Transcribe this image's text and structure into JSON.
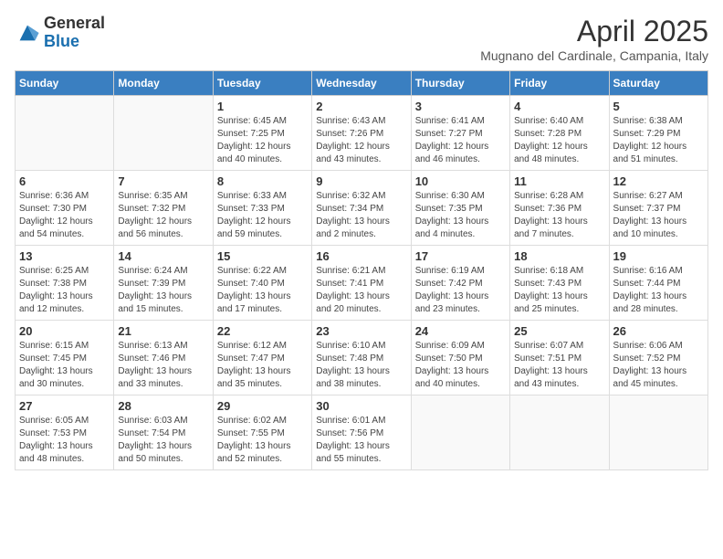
{
  "logo": {
    "general": "General",
    "blue": "Blue"
  },
  "title": "April 2025",
  "subtitle": "Mugnano del Cardinale, Campania, Italy",
  "days_of_week": [
    "Sunday",
    "Monday",
    "Tuesday",
    "Wednesday",
    "Thursday",
    "Friday",
    "Saturday"
  ],
  "weeks": [
    [
      {
        "day": "",
        "info": ""
      },
      {
        "day": "",
        "info": ""
      },
      {
        "day": "1",
        "info": "Sunrise: 6:45 AM\nSunset: 7:25 PM\nDaylight: 12 hours and 40 minutes."
      },
      {
        "day": "2",
        "info": "Sunrise: 6:43 AM\nSunset: 7:26 PM\nDaylight: 12 hours and 43 minutes."
      },
      {
        "day": "3",
        "info": "Sunrise: 6:41 AM\nSunset: 7:27 PM\nDaylight: 12 hours and 46 minutes."
      },
      {
        "day": "4",
        "info": "Sunrise: 6:40 AM\nSunset: 7:28 PM\nDaylight: 12 hours and 48 minutes."
      },
      {
        "day": "5",
        "info": "Sunrise: 6:38 AM\nSunset: 7:29 PM\nDaylight: 12 hours and 51 minutes."
      }
    ],
    [
      {
        "day": "6",
        "info": "Sunrise: 6:36 AM\nSunset: 7:30 PM\nDaylight: 12 hours and 54 minutes."
      },
      {
        "day": "7",
        "info": "Sunrise: 6:35 AM\nSunset: 7:32 PM\nDaylight: 12 hours and 56 minutes."
      },
      {
        "day": "8",
        "info": "Sunrise: 6:33 AM\nSunset: 7:33 PM\nDaylight: 12 hours and 59 minutes."
      },
      {
        "day": "9",
        "info": "Sunrise: 6:32 AM\nSunset: 7:34 PM\nDaylight: 13 hours and 2 minutes."
      },
      {
        "day": "10",
        "info": "Sunrise: 6:30 AM\nSunset: 7:35 PM\nDaylight: 13 hours and 4 minutes."
      },
      {
        "day": "11",
        "info": "Sunrise: 6:28 AM\nSunset: 7:36 PM\nDaylight: 13 hours and 7 minutes."
      },
      {
        "day": "12",
        "info": "Sunrise: 6:27 AM\nSunset: 7:37 PM\nDaylight: 13 hours and 10 minutes."
      }
    ],
    [
      {
        "day": "13",
        "info": "Sunrise: 6:25 AM\nSunset: 7:38 PM\nDaylight: 13 hours and 12 minutes."
      },
      {
        "day": "14",
        "info": "Sunrise: 6:24 AM\nSunset: 7:39 PM\nDaylight: 13 hours and 15 minutes."
      },
      {
        "day": "15",
        "info": "Sunrise: 6:22 AM\nSunset: 7:40 PM\nDaylight: 13 hours and 17 minutes."
      },
      {
        "day": "16",
        "info": "Sunrise: 6:21 AM\nSunset: 7:41 PM\nDaylight: 13 hours and 20 minutes."
      },
      {
        "day": "17",
        "info": "Sunrise: 6:19 AM\nSunset: 7:42 PM\nDaylight: 13 hours and 23 minutes."
      },
      {
        "day": "18",
        "info": "Sunrise: 6:18 AM\nSunset: 7:43 PM\nDaylight: 13 hours and 25 minutes."
      },
      {
        "day": "19",
        "info": "Sunrise: 6:16 AM\nSunset: 7:44 PM\nDaylight: 13 hours and 28 minutes."
      }
    ],
    [
      {
        "day": "20",
        "info": "Sunrise: 6:15 AM\nSunset: 7:45 PM\nDaylight: 13 hours and 30 minutes."
      },
      {
        "day": "21",
        "info": "Sunrise: 6:13 AM\nSunset: 7:46 PM\nDaylight: 13 hours and 33 minutes."
      },
      {
        "day": "22",
        "info": "Sunrise: 6:12 AM\nSunset: 7:47 PM\nDaylight: 13 hours and 35 minutes."
      },
      {
        "day": "23",
        "info": "Sunrise: 6:10 AM\nSunset: 7:48 PM\nDaylight: 13 hours and 38 minutes."
      },
      {
        "day": "24",
        "info": "Sunrise: 6:09 AM\nSunset: 7:50 PM\nDaylight: 13 hours and 40 minutes."
      },
      {
        "day": "25",
        "info": "Sunrise: 6:07 AM\nSunset: 7:51 PM\nDaylight: 13 hours and 43 minutes."
      },
      {
        "day": "26",
        "info": "Sunrise: 6:06 AM\nSunset: 7:52 PM\nDaylight: 13 hours and 45 minutes."
      }
    ],
    [
      {
        "day": "27",
        "info": "Sunrise: 6:05 AM\nSunset: 7:53 PM\nDaylight: 13 hours and 48 minutes."
      },
      {
        "day": "28",
        "info": "Sunrise: 6:03 AM\nSunset: 7:54 PM\nDaylight: 13 hours and 50 minutes."
      },
      {
        "day": "29",
        "info": "Sunrise: 6:02 AM\nSunset: 7:55 PM\nDaylight: 13 hours and 52 minutes."
      },
      {
        "day": "30",
        "info": "Sunrise: 6:01 AM\nSunset: 7:56 PM\nDaylight: 13 hours and 55 minutes."
      },
      {
        "day": "",
        "info": ""
      },
      {
        "day": "",
        "info": ""
      },
      {
        "day": "",
        "info": ""
      }
    ]
  ]
}
